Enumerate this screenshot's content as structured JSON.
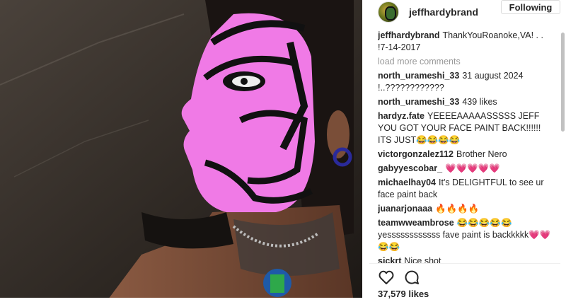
{
  "post": {
    "username": "jeffhardybrand",
    "follow_label": "Following",
    "caption_user": "jeffhardybrand",
    "caption_text": "ThankYouRoanoke,VA! . . !7-14-2017",
    "load_more": "load more comments",
    "likes": "37,579 likes"
  },
  "comments": [
    {
      "user": "north_urameshi_33",
      "text": "31 august 2024 !..????????????"
    },
    {
      "user": "north_urameshi_33",
      "text": "439 likes"
    },
    {
      "user": "hardyz.fate",
      "text": "YEEEEAAAAASSSSS JEFF YOU GOT YOUR FACE PAINT BACK!!!!!! ITS JUST😂😂😂😂"
    },
    {
      "user": "victorgonzalez112",
      "text": "Brother Nero"
    },
    {
      "user": "gabyyescobar_",
      "text": "💗💗💗💗💗"
    },
    {
      "user": "michaelhay04",
      "text": "It's DELIGHTFUL to see ur face paint back"
    },
    {
      "user": "juanarjonaaa",
      "text": "🔥🔥🔥🔥"
    },
    {
      "user": "teamwweambrose",
      "text": "😂😂😂😂😂 yessssssssssss fave paint is backkkkk💗💗😂😂"
    },
    {
      "user": "sickrt",
      "text": "Nice shot"
    }
  ],
  "icons": {
    "like": "heart-icon",
    "comment": "comment-bubble-icon"
  },
  "colors": {
    "face_paint": "#f07ae6",
    "text": "#262626",
    "muted": "#999999"
  }
}
